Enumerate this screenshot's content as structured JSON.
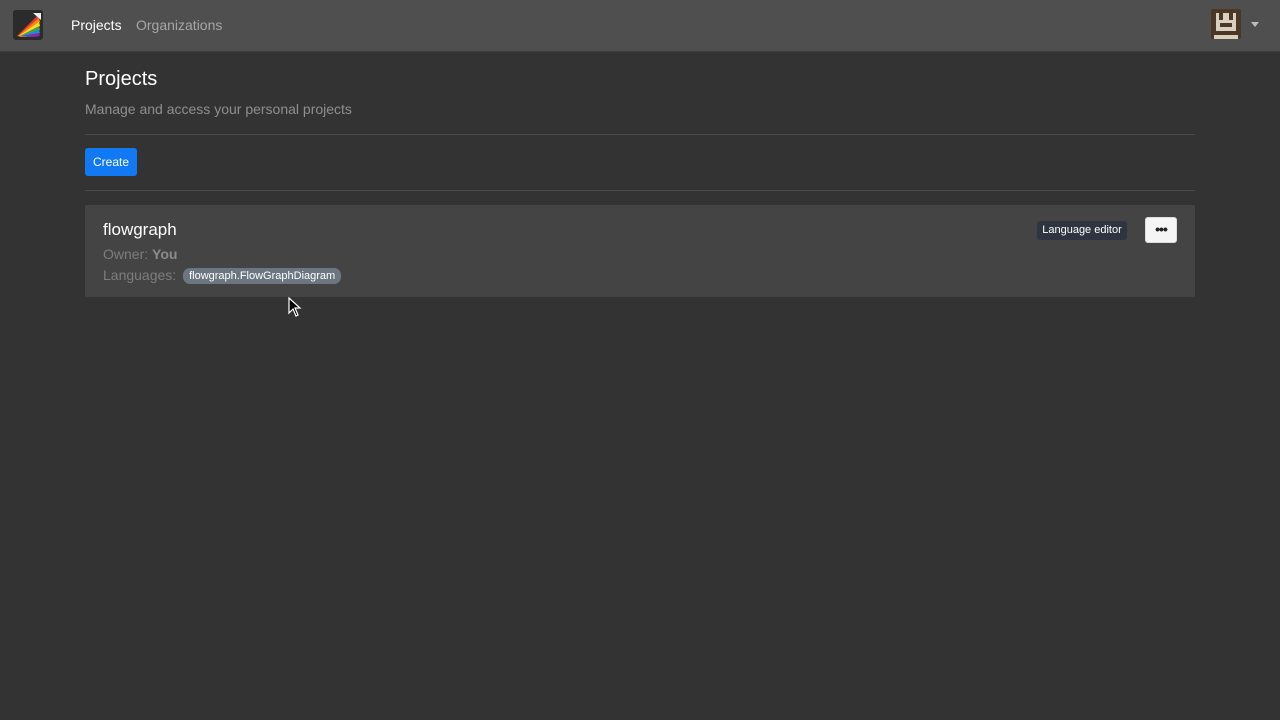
{
  "navbar": {
    "logo_icon": "rainbow-pen-logo-icon",
    "links": [
      {
        "label": "Projects",
        "active": true
      },
      {
        "label": "Organizations",
        "active": false
      }
    ],
    "user_avatar_icon": "pixel-avatar-icon",
    "user_menu_icon": "caret-down-icon"
  },
  "page": {
    "title": "Projects",
    "subtitle": "Manage and access your personal projects",
    "create_label": "Create"
  },
  "projects": [
    {
      "name": "flowgraph",
      "owner_label": "Owner:",
      "owner_value": "You",
      "languages_label": "Languages:",
      "languages": [
        "flowgraph.FlowGraphDiagram"
      ],
      "language_editor_label": "Language editor",
      "more_icon": "ellipsis-icon",
      "more_label": "•••"
    }
  ],
  "colors": {
    "background": "#333333",
    "navbar": "#4f4f4f",
    "card": "#444444",
    "primary": "#1279f5",
    "badge": "#6b7681"
  }
}
